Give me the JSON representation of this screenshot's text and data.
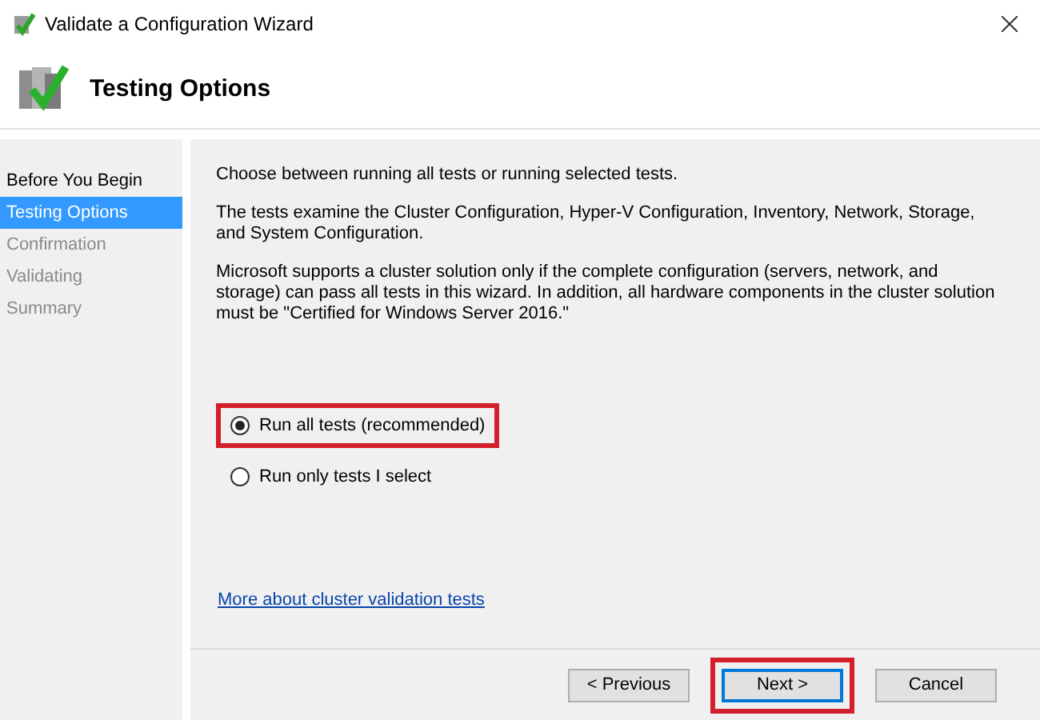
{
  "window": {
    "title": "Validate a Configuration Wizard"
  },
  "header": {
    "title": "Testing Options"
  },
  "steps": [
    {
      "label": "Before You Begin",
      "selected": false,
      "disabled": false
    },
    {
      "label": "Testing Options",
      "selected": true,
      "disabled": false
    },
    {
      "label": "Confirmation",
      "selected": false,
      "disabled": true
    },
    {
      "label": "Validating",
      "selected": false,
      "disabled": true
    },
    {
      "label": "Summary",
      "selected": false,
      "disabled": true
    }
  ],
  "paragraphs": [
    "Choose between running all tests or running selected tests.",
    "The tests examine the Cluster Configuration, Hyper-V Configuration, Inventory, Network, Storage, and System Configuration.",
    "Microsoft supports a cluster solution only if the complete configuration (servers, network, and storage) can pass all tests in this wizard. In addition, all hardware components in the cluster solution must be \"Certified for Windows Server 2016.\""
  ],
  "options": [
    {
      "label": "Run all tests (recommended)",
      "selected": true,
      "highlighted": true
    },
    {
      "label": "Run only tests I select",
      "selected": false,
      "highlighted": false
    }
  ],
  "link": "More about cluster validation tests",
  "buttons": [
    {
      "label": "< Previous",
      "default": false,
      "highlighted": false
    },
    {
      "label": "Next >",
      "default": true,
      "highlighted": true
    },
    {
      "label": "Cancel",
      "default": false,
      "highlighted": false
    }
  ]
}
